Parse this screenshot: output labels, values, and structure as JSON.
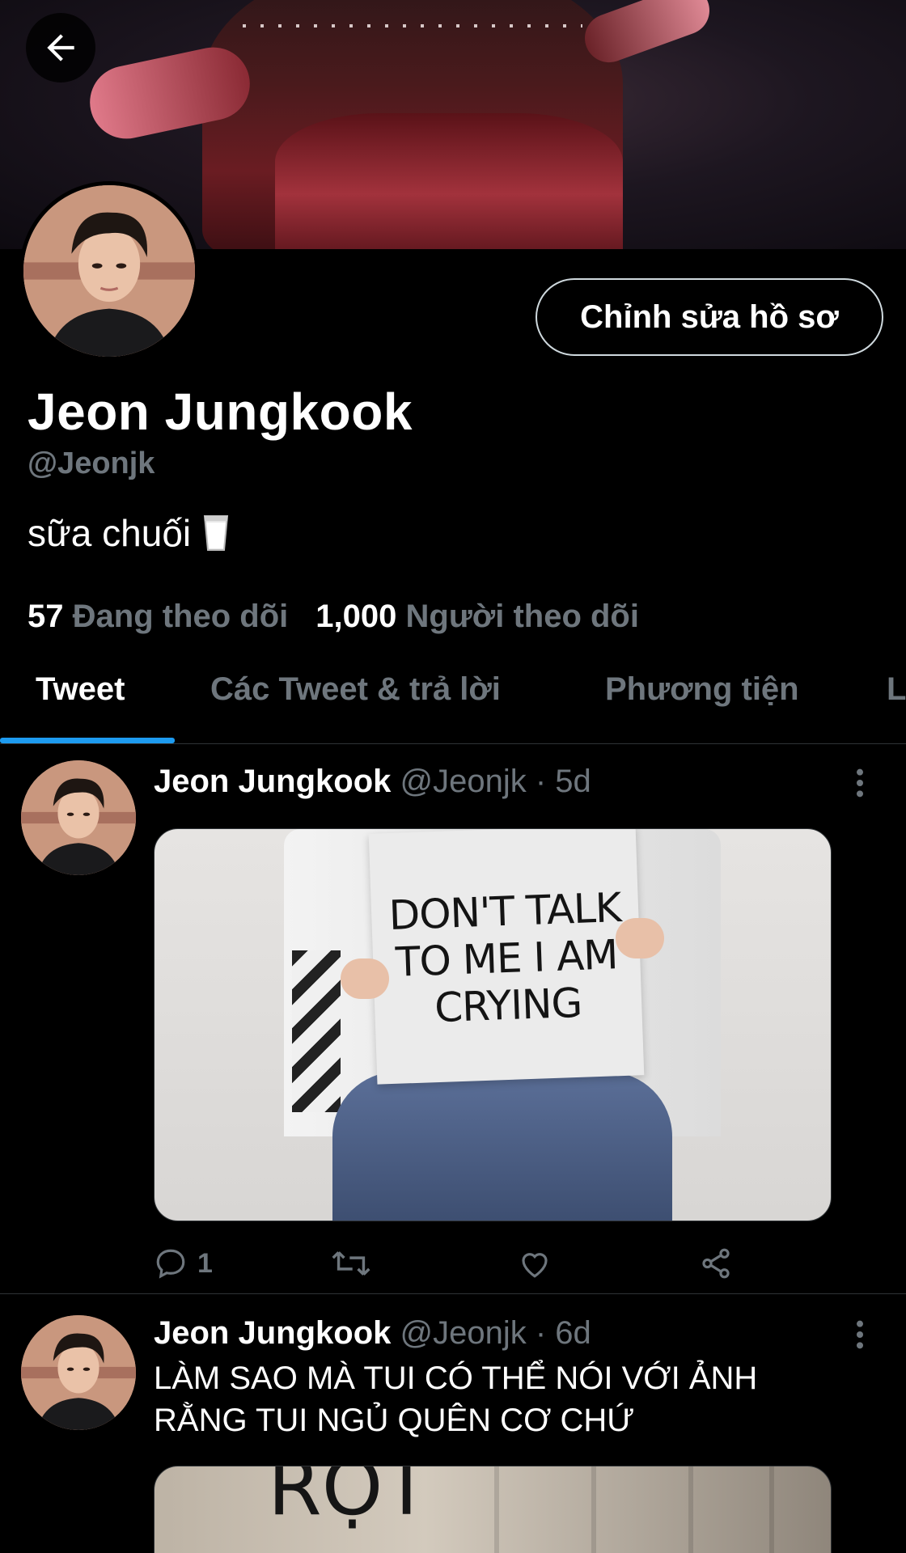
{
  "profile": {
    "display_name": "Jeon Jungkook",
    "handle": "@Jeonjk",
    "bio": "sữa chuối",
    "bio_emoji": "milk-glass-icon",
    "edit_button_label": "Chỉnh sửa hồ sơ",
    "following_count": "57",
    "following_label": "Đang theo dõi",
    "followers_count": "1,000",
    "followers_label": "Người theo dõi"
  },
  "tabs": [
    {
      "label": "Tweet",
      "active": true
    },
    {
      "label": "Các Tweet & trả lời",
      "active": false
    },
    {
      "label": "Phương tiện",
      "active": false
    },
    {
      "label": "L",
      "active": false
    }
  ],
  "tweets": [
    {
      "name": "Jeon Jungkook",
      "meta": "@Jeonjk · 5d",
      "text": "",
      "image_text": [
        "DON'T TALK",
        "TO ME I AM",
        "CRYING"
      ],
      "reply_count": "1",
      "retweet_count": "",
      "like_count": ""
    },
    {
      "name": "Jeon Jungkook",
      "meta": "@Jeonjk · 6d",
      "text_line1": "LÀM SAO MÀ TUI CÓ THỂ NÓI VỚI ẢNH",
      "text_line2": "RẰNG TUI NGỦ QUÊN CƠ CHỨ",
      "image_text": "RỌT"
    }
  ],
  "colors": {
    "background": "#000000",
    "muted": "#6e767d",
    "accent": "#1d9bf0",
    "divider": "#2f3336"
  }
}
